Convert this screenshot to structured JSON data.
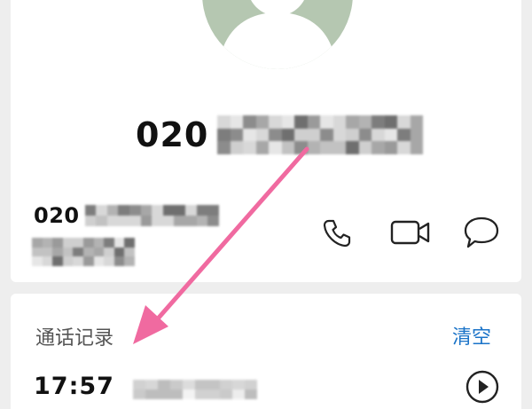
{
  "contact": {
    "avatar_icon": "default-person-avatar",
    "number_prefix": "020",
    "number_redacted": true
  },
  "detail": {
    "number_prefix": "020",
    "number_redacted": true,
    "subtitle_redacted": true
  },
  "actions": [
    {
      "name": "call",
      "icon": "phone-icon"
    },
    {
      "name": "video-call",
      "icon": "video-camera-icon"
    },
    {
      "name": "message",
      "icon": "chat-bubble-icon"
    }
  ],
  "call_log": {
    "title": "通话记录",
    "clear_label": "清空",
    "entries": [
      {
        "time": "17:57",
        "details_redacted": true,
        "icon": "play-icon"
      }
    ]
  },
  "colors": {
    "accent": "#1a73c8",
    "avatar_bg": "#b5c7b1",
    "annotation": "#f06aa0",
    "page_bg": "#eeeeee"
  }
}
